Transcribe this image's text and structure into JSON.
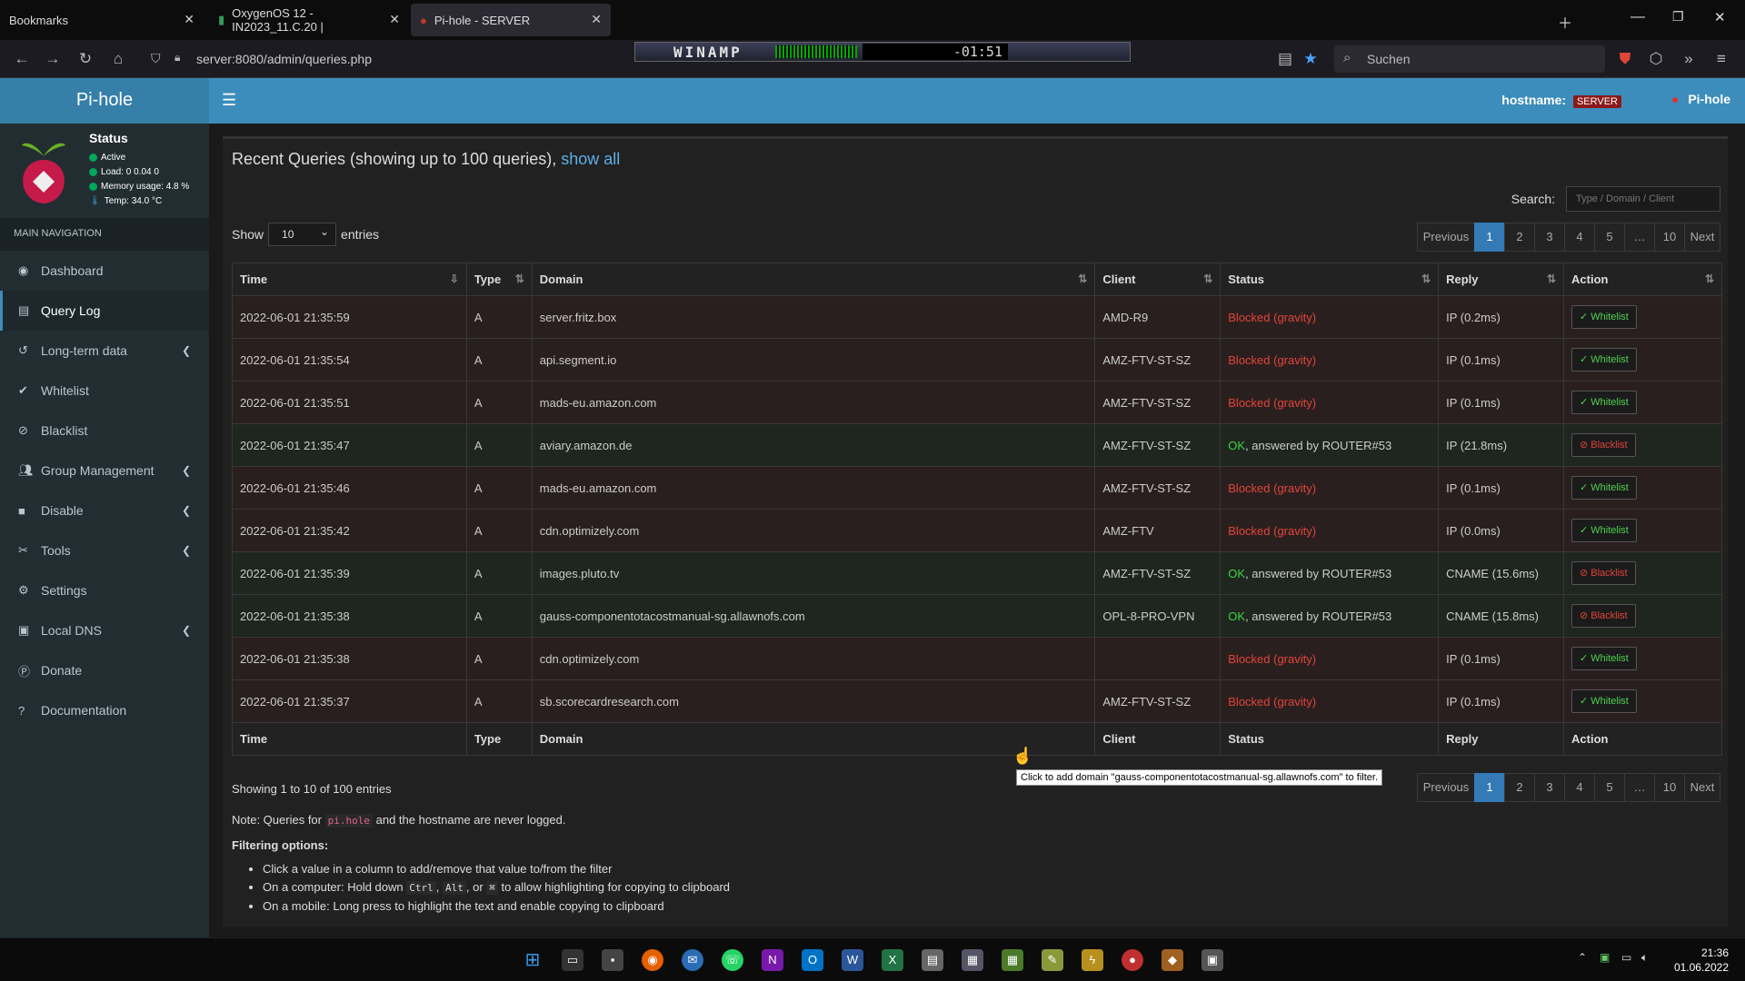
{
  "browser": {
    "tabs": [
      {
        "label": "Bookmarks"
      },
      {
        "label": "OxygenOS 12 - IN2023_11.C.20 |"
      },
      {
        "label": "Pi-hole - SERVER"
      }
    ],
    "url": "server:8080/admin/queries.php",
    "search_placeholder": "Suchen"
  },
  "winamp": {
    "title": "WINAMP",
    "time": "-01:51"
  },
  "header": {
    "logo": "Pi-hole",
    "hostname_label": "hostname:",
    "hostname": "SERVER",
    "user": "Pi-hole"
  },
  "status": {
    "title": "Status",
    "active": "Active",
    "load": "Load:  0  0.04  0",
    "memory": "Memory usage:  4.8 %",
    "temp": "Temp: 34.0 °C"
  },
  "sidebar": {
    "heading": "MAIN NAVIGATION",
    "items": [
      {
        "label": "Dashboard",
        "icon": "dashboard-icon"
      },
      {
        "label": "Query Log",
        "icon": "file-icon",
        "active": true
      },
      {
        "label": "Long-term data",
        "icon": "history-icon"
      },
      {
        "label": "Whitelist",
        "icon": "check-circle-icon"
      },
      {
        "label": "Blacklist",
        "icon": "ban-icon"
      },
      {
        "label": "Group Management",
        "icon": "users-icon"
      },
      {
        "label": "Disable",
        "icon": "stop-icon"
      },
      {
        "label": "Tools",
        "icon": "tools-icon"
      },
      {
        "label": "Settings",
        "icon": "gear-icon"
      },
      {
        "label": "Local DNS",
        "icon": "address-book-icon"
      },
      {
        "label": "Donate",
        "icon": "paypal-icon"
      },
      {
        "label": "Documentation",
        "icon": "question-icon"
      }
    ]
  },
  "main": {
    "title": "Recent Queries (showing up to 100 queries),",
    "title_link": "show all",
    "show_label": "Show",
    "entries_value": "10",
    "entries_label": "entries",
    "search_label": "Search:",
    "search_placeholder": "Type / Domain / Client",
    "pager": [
      "Previous",
      "1",
      "2",
      "3",
      "4",
      "5",
      "…",
      "10",
      "Next"
    ],
    "columns": [
      "Time",
      "Type",
      "Domain",
      "Client",
      "Status",
      "Reply",
      "Action"
    ],
    "rows": [
      {
        "time": "2022-06-01 21:35:59",
        "type": "A",
        "domain": "server.fritz.box",
        "client": "AMD-R9",
        "status": "Blocked (gravity)",
        "status_ok": "",
        "reply": "IP (0.2ms)",
        "action": "Whitelist",
        "kind": "blk"
      },
      {
        "time": "2022-06-01 21:35:54",
        "type": "A",
        "domain": "api.segment.io",
        "client": "AMZ-FTV-ST-SZ",
        "status": "Blocked (gravity)",
        "status_ok": "",
        "reply": "IP (0.1ms)",
        "action": "Whitelist",
        "kind": "blk"
      },
      {
        "time": "2022-06-01 21:35:51",
        "type": "A",
        "domain": "mads-eu.amazon.com",
        "client": "AMZ-FTV-ST-SZ",
        "status": "Blocked (gravity)",
        "status_ok": "",
        "reply": "IP (0.1ms)",
        "action": "Whitelist",
        "kind": "blk"
      },
      {
        "time": "2022-06-01 21:35:47",
        "type": "A",
        "domain": "aviary.amazon.de",
        "client": "AMZ-FTV-ST-SZ",
        "status": "OK",
        "status_ok": ", answered by ROUTER#53",
        "reply": "IP (21.8ms)",
        "action": "Blacklist",
        "kind": "ok"
      },
      {
        "time": "2022-06-01 21:35:46",
        "type": "A",
        "domain": "mads-eu.amazon.com",
        "client": "AMZ-FTV-ST-SZ",
        "status": "Blocked (gravity)",
        "status_ok": "",
        "reply": "IP (0.1ms)",
        "action": "Whitelist",
        "kind": "blk"
      },
      {
        "time": "2022-06-01 21:35:42",
        "type": "A",
        "domain": "cdn.optimizely.com",
        "client": "AMZ-FTV",
        "status": "Blocked (gravity)",
        "status_ok": "",
        "reply": "IP (0.0ms)",
        "action": "Whitelist",
        "kind": "blk"
      },
      {
        "time": "2022-06-01 21:35:39",
        "type": "A",
        "domain": "images.pluto.tv",
        "client": "AMZ-FTV-ST-SZ",
        "status": "OK",
        "status_ok": ", answered by ROUTER#53",
        "reply": "CNAME (15.6ms)",
        "action": "Blacklist",
        "kind": "ok"
      },
      {
        "time": "2022-06-01 21:35:38",
        "type": "A",
        "domain": "gauss-componentotacostmanual-sg.allawnofs.com",
        "client": "OPL-8-PRO-VPN",
        "status": "OK",
        "status_ok": ", answered by ROUTER#53",
        "reply": "CNAME (15.8ms)",
        "action": "Blacklist",
        "kind": "ok"
      },
      {
        "time": "2022-06-01 21:35:38",
        "type": "A",
        "domain": "cdn.optimizely.com",
        "client": "",
        "status": "Blocked (gravity)",
        "status_ok": "",
        "reply": "IP (0.1ms)",
        "action": "Whitelist",
        "kind": "blk"
      },
      {
        "time": "2022-06-01 21:35:37",
        "type": "A",
        "domain": "sb.scorecardresearch.com",
        "client": "AMZ-FTV-ST-SZ",
        "status": "Blocked (gravity)",
        "status_ok": "",
        "reply": "IP (0.1ms)",
        "action": "Whitelist",
        "kind": "blk"
      }
    ],
    "tooltip": "Click to add domain \"gauss-componentotacostmanual-sg.allawnofs.com\" to filter.",
    "showing": "Showing 1 to 10 of 100 entries",
    "note_prefix": "Note: Queries for",
    "note_code": "pi.hole",
    "note_suffix": "and the hostname are never logged.",
    "filter_heading": "Filtering options:",
    "filter_1": "Click a value in a column to add/remove that value to/from the filter",
    "filter_2a": "On a computer: Hold down",
    "filter_2_ctrl": "Ctrl",
    "filter_2_alt": "Alt",
    "filter_2_or": ", or",
    "filter_2_cmd": "⌘",
    "filter_2b": "to allow highlighting for copying to clipboard",
    "filter_3": "On a mobile: Long press to highlight the text and enable copying to clipboard"
  },
  "taskbar": {
    "time": "21:36",
    "date": "01.06.2022"
  },
  "colors": {
    "accent": "#3c8dbc",
    "blocked": "#e0453a",
    "ok": "#3fd43f",
    "sidebar": "#222d32"
  }
}
